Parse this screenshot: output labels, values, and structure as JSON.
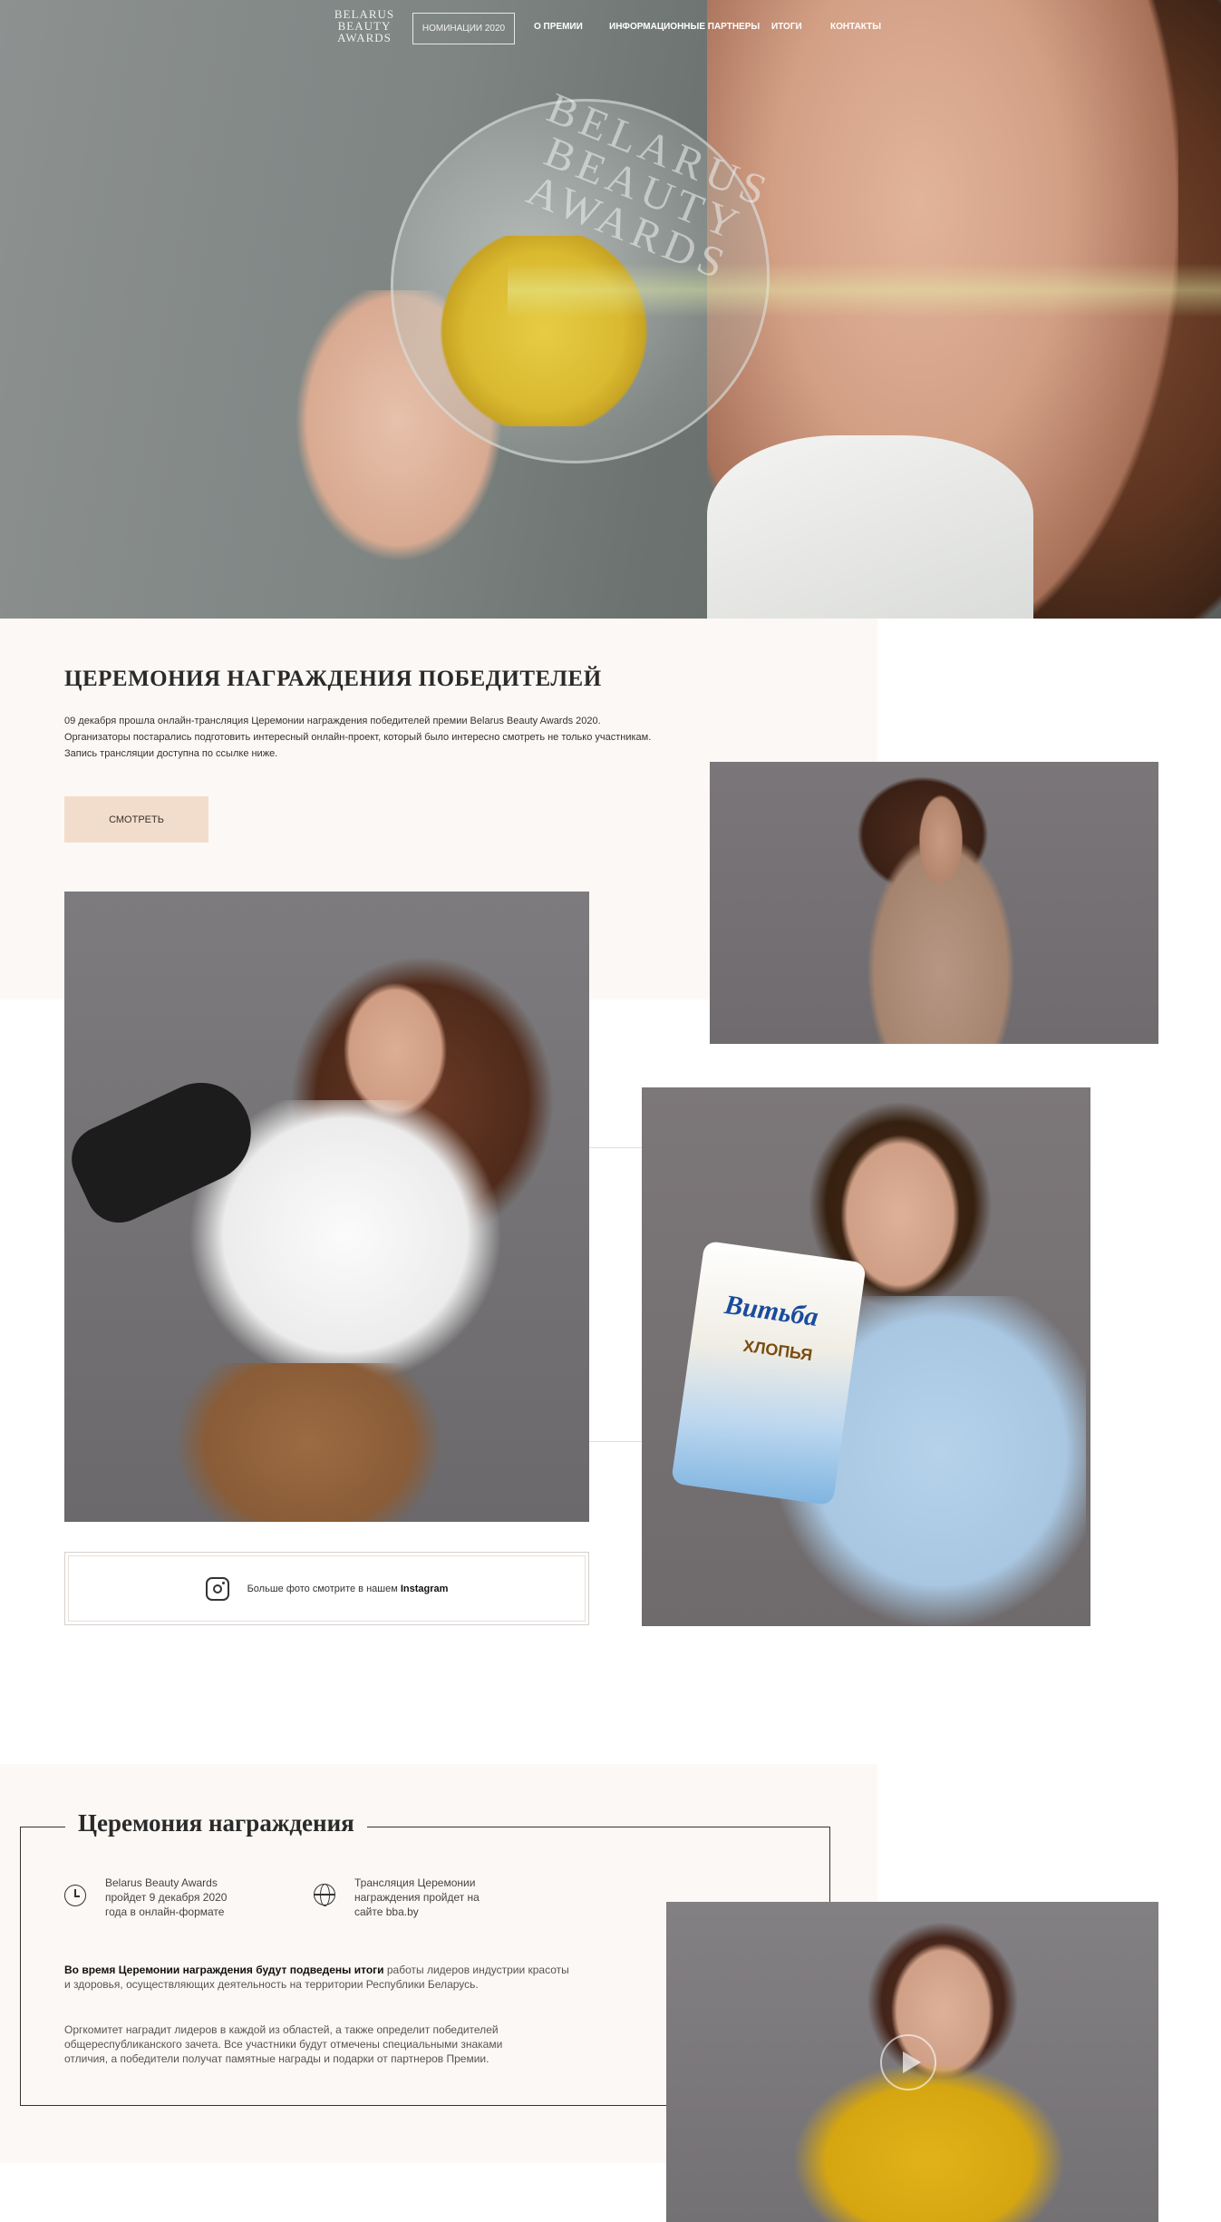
{
  "nav": {
    "logo_lines": [
      "BELARUS",
      "BEAUTY",
      "AWARDS"
    ],
    "primary_button": "НОМИНАЦИИ 2020",
    "links": [
      "О ПРЕМИИ",
      "ИНФОРМАЦИОННЫЕ ПАРТНЕРЫ",
      "ИТОГИ",
      "КОНТАКТЫ"
    ]
  },
  "hero": {
    "trophy_engraving": "BELARUS BEAUTY AWARDS"
  },
  "ceremony": {
    "title": "ЦЕРЕМОНИЯ НАГРАЖДЕНИЯ ПОБЕДИТЕЛЕЙ",
    "lines": [
      "09 декабря прошла онлайн-трансляция Церемонии награждения победителей премии Belarus Beauty Awards 2020.",
      "Организаторы постарались подготовить интересный онлайн-проект, который было интересно смотреть не только участникам.",
      "Запись трансляции доступна по ссылке ниже."
    ],
    "watch_button": "СМОТРЕТЬ"
  },
  "gallery": {
    "package_brand": "Витьба",
    "package_label": "ХЛОПЬЯ"
  },
  "instagram": {
    "text": "Больше фото смотрите в нашем",
    "link": "Instagram"
  },
  "info": {
    "title": "Церемония награждения",
    "item1": "Belarus Beauty Awards пройдет 9 декабря 2020 года в онлайн-формате",
    "item2": "Трансляция Церемонии награждения пройдет на сайте bba.by",
    "para1_bold": "Во время Церемонии награждения будут подведены итоги",
    "para1_rest": " работы лидеров индустрии красоты и здоровья, осуществляющих деятельность на территории Республики Беларусь.",
    "para2": "Оргкомитет наградит лидеров в каждой из областей, а также определит победителей общереспубликанского зачета. Все участники будут отмечены специальными знаками отличия, а победители получат памятные награды и подарки от партнеров Премии."
  }
}
